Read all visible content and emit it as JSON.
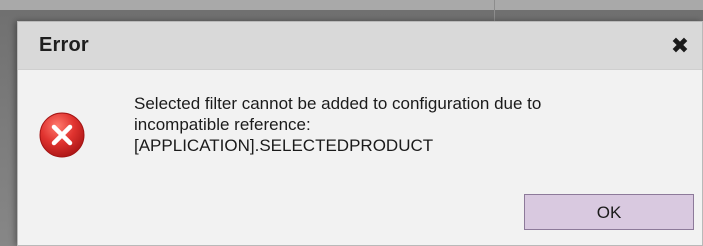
{
  "dialog": {
    "title": "Error",
    "close_icon": "close-icon",
    "status_icon": "error-icon",
    "message_lines": [
      "Selected filter cannot be added to configuration due to",
      "incompatible reference:",
      "[APPLICATION].SELECTEDPRODUCT"
    ],
    "ok_label": "OK"
  },
  "colors": {
    "titlebar": "#d9d9d9",
    "body": "#f2f2f2",
    "error_red": "#d9282c",
    "button_fill": "#d9c9e0",
    "button_border": "#8d7a9a"
  }
}
